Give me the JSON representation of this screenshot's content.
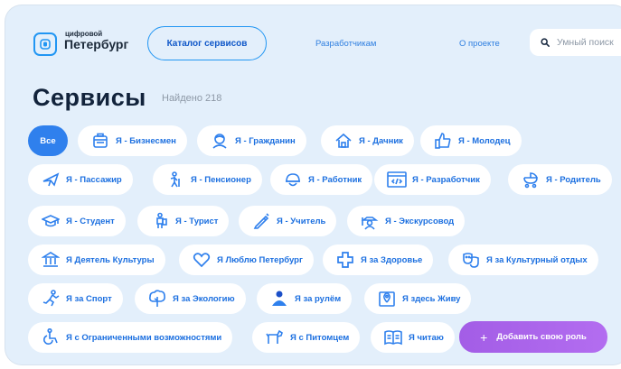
{
  "header": {
    "logo_small": "цифровой",
    "logo_big": "Петербург",
    "catalog_label": "Каталог сервисов",
    "developers_label": "Разработчикам",
    "about_label": "О проекте",
    "search_placeholder": "Умный поиск",
    "search_value": ""
  },
  "main": {
    "title": "Сервисы",
    "found": "Найдено 218"
  },
  "roles": {
    "all": "Все",
    "items": [
      {
        "label": "Я - Бизнесмен",
        "icon": "briefcase-icon"
      },
      {
        "label": "Я - Гражданин",
        "icon": "citizen-icon"
      },
      {
        "label": "Я - Дачник",
        "icon": "country-house-icon"
      },
      {
        "label": "Я - Молодец",
        "icon": "thumbs-up-icon"
      },
      {
        "label": "Я - Пассажир",
        "icon": "airplane-icon"
      },
      {
        "label": "Я - Пенсионер",
        "icon": "pensioner-icon"
      },
      {
        "label": "Я - Работник",
        "icon": "hard-hat-icon"
      },
      {
        "label": "Я - Разработчик",
        "icon": "code-window-icon"
      },
      {
        "label": "Я - Родитель",
        "icon": "stroller-icon"
      },
      {
        "label": "Я - Студент",
        "icon": "graduation-cap-icon"
      },
      {
        "label": "Я - Турист",
        "icon": "tourist-icon"
      },
      {
        "label": "Я - Учитель",
        "icon": "pen-icon"
      },
      {
        "label": "Я - Экскурсовод",
        "icon": "guide-icon"
      },
      {
        "label": "Я Деятель Культуры",
        "icon": "museum-icon"
      },
      {
        "label": "Я Люблю Петербург",
        "icon": "heart-icon"
      },
      {
        "label": "Я за Здоровье",
        "icon": "medical-cross-icon"
      },
      {
        "label": "Я за Культурный отдых",
        "icon": "theatre-masks-icon"
      },
      {
        "label": "Я за Спорт",
        "icon": "runner-icon"
      },
      {
        "label": "Я за Экологию",
        "icon": "tree-icon"
      },
      {
        "label": "Я за рулём",
        "icon": "driver-icon"
      },
      {
        "label": "Я здесь Живу",
        "icon": "map-pin-icon"
      },
      {
        "label": "Я с Ограниченными возможностями",
        "icon": "wheelchair-icon"
      },
      {
        "label": "Я с Питомцем",
        "icon": "dog-icon"
      },
      {
        "label": "Я читаю",
        "icon": "book-icon"
      }
    ],
    "add_label": "Добавить свою роль",
    "add_icon": "plus-icon"
  },
  "colors": {
    "background": "#e3effb",
    "accent": "#2f80ed",
    "chip_text": "#1b6fe0",
    "add_button": "#a35de6"
  }
}
